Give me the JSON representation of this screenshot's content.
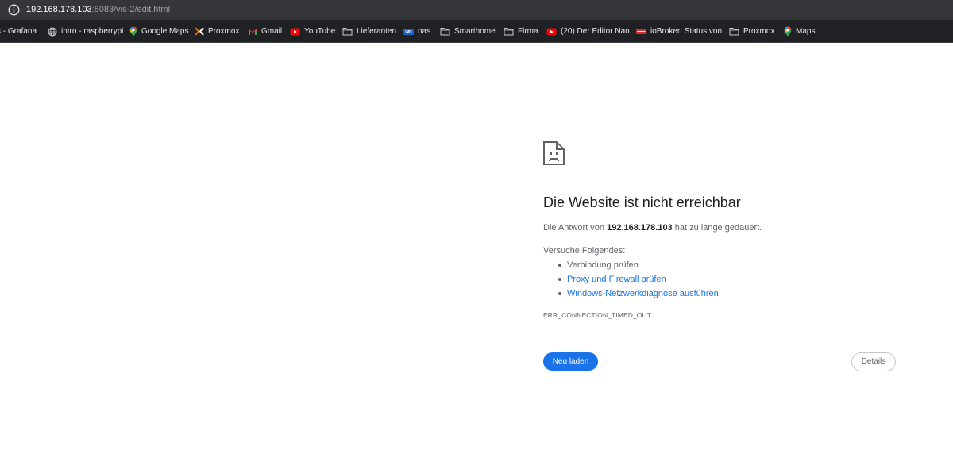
{
  "address_bar": {
    "icon": "info-icon",
    "url_host": "192.168.178.103",
    "url_rest": ":8083/vis-2/edit.html"
  },
  "bookmarks": [
    {
      "label": "s - Grafana",
      "icon": "none"
    },
    {
      "label": "intro - raspberrypi",
      "icon": "globe-icon"
    },
    {
      "label": "Google Maps",
      "icon": "maps-pin-icon"
    },
    {
      "label": "Proxmox",
      "icon": "proxmox-icon"
    },
    {
      "label": "Gmail",
      "icon": "gmail-icon"
    },
    {
      "label": "YouTube",
      "icon": "youtube-icon"
    },
    {
      "label": "Lieferanten",
      "icon": "folder-icon"
    },
    {
      "label": "nas",
      "icon": "wd-icon"
    },
    {
      "label": "Smarthome",
      "icon": "folder-icon"
    },
    {
      "label": "Firma",
      "icon": "folder-icon"
    },
    {
      "label": "(20) Der Editor Nan...",
      "icon": "youtube-icon"
    },
    {
      "label": "ioBroker: Status von...",
      "icon": "iobroker-icon"
    },
    {
      "label": "Proxmox",
      "icon": "folder-icon"
    },
    {
      "label": "Maps",
      "icon": "maps-pin-icon"
    }
  ],
  "error_page": {
    "icon": "sad-page-icon",
    "title": "Die Website ist nicht erreichbar",
    "desc_prefix": "Die Antwort von ",
    "desc_host": "192.168.178.103",
    "desc_suffix": " hat zu lange gedauert.",
    "try_label": "Versuche Folgendes:",
    "suggestions": [
      {
        "text": "Verbindung prüfen",
        "link": false
      },
      {
        "text": "Proxy und Firewall prüfen",
        "link": true
      },
      {
        "text": "Windows-Netzwerkdiagnose ausführen",
        "link": true
      }
    ],
    "error_code": "ERR_CONNECTION_TIMED_OUT",
    "reload_label": "Neu laden",
    "details_label": "Details"
  },
  "colors": {
    "address_bar_bg": "#35363a",
    "bookmarks_bg": "#202124",
    "link": "#1a73e8",
    "button": "#1a73e8",
    "text_muted": "#5f6368"
  }
}
